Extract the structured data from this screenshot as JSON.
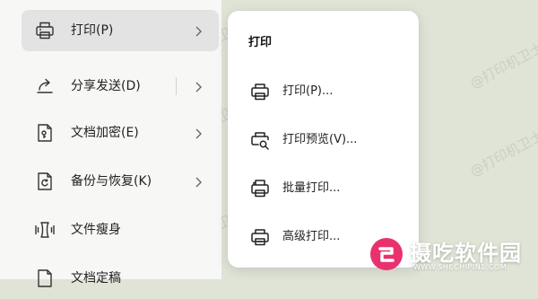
{
  "main_menu": {
    "items": [
      {
        "label": "打印(P)",
        "icon": "printer-icon",
        "has_divider": false,
        "has_submenu": true,
        "selected": true
      },
      {
        "label": "分享发送(D)",
        "icon": "share-icon",
        "has_divider": true,
        "has_submenu": true,
        "selected": false
      },
      {
        "label": "文档加密(E)",
        "icon": "document-lock-icon",
        "has_divider": false,
        "has_submenu": true,
        "selected": false
      },
      {
        "label": "备份与恢复(K)",
        "icon": "backup-restore-icon",
        "has_divider": false,
        "has_submenu": true,
        "selected": false
      },
      {
        "label": "文件瘦身",
        "icon": "file-slim-icon",
        "has_divider": false,
        "has_submenu": false,
        "selected": false
      },
      {
        "label": "文档定稿",
        "icon": "document-finalize-icon",
        "has_divider": false,
        "has_submenu": false,
        "selected": false
      }
    ]
  },
  "submenu": {
    "title": "打印",
    "items": [
      {
        "label": "打印(P)...",
        "icon": "printer-icon"
      },
      {
        "label": "打印预览(V)...",
        "icon": "print-preview-icon"
      },
      {
        "label": "批量打印...",
        "icon": "batch-print-icon"
      },
      {
        "label": "高级打印...",
        "icon": "advanced-print-icon"
      }
    ]
  },
  "watermark": {
    "text": "@打印机卫士"
  },
  "brand": {
    "name": "摄吃软件园",
    "url": "WWW.SHECHIPIN1.COM"
  },
  "colors": {
    "background": "#dfe4d6",
    "menu_bg": "#f7f7f6",
    "selected_bg": "#e3e3e3",
    "submenu_bg": "#ffffff",
    "brand_logo": "#e8316d"
  }
}
